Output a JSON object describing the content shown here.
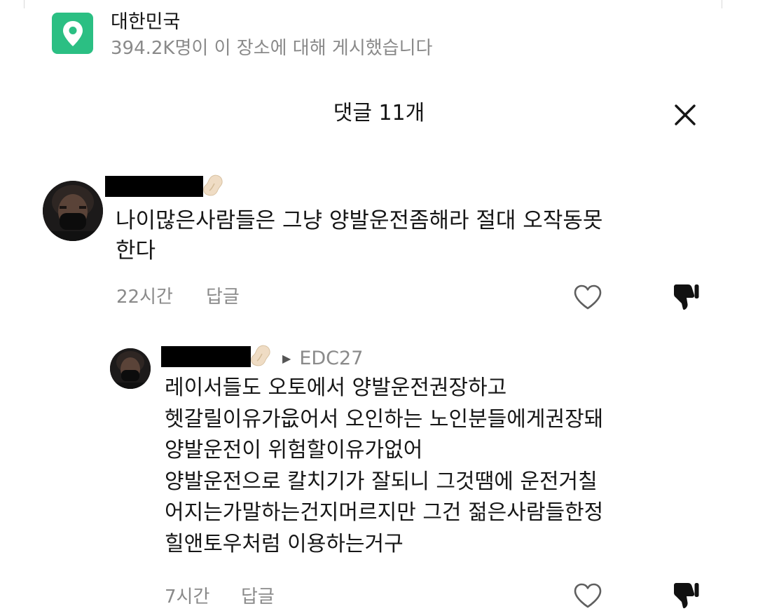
{
  "location": {
    "name": "대한민국",
    "subtitle": "394.2K명이 이 장소에 대해 게시했습니다",
    "icon": "location-pin-icon",
    "accent_color": "#2bbf83"
  },
  "comments_header": {
    "title": "댓글 11개",
    "close_icon": "close-icon"
  },
  "comments": [
    {
      "author_redacted": true,
      "badge_icon": "peanut-badge-icon",
      "text_lines": [
        "나이많은사람들은 그냥 양발운전좀해라 절대 오작동못",
        "한다"
      ],
      "time": "22시간",
      "reply_label": "답글",
      "like_icon": "heart-outline-icon",
      "dislike_icon": "thumbs-down-icon"
    },
    {
      "author_redacted": true,
      "badge_icon": "peanut-badge-icon",
      "reply_to": "EDC27",
      "text_lines": [
        "레이서들도 오토에서 양발운전권장하고",
        "헷갈릴이유가읎어서 오인하는 노인분들에게권장돼",
        "양발운전이 위험할이유가없어",
        "양발운전으로 칼치기가 잘되니 그것땜에 운전거칠",
        "어지는가말하는건지머르지만 그건 젊은사람들한정",
        "힐앤토우처럼 이용하는거구"
      ],
      "time": "7시간",
      "reply_label": "답글",
      "like_icon": "heart-outline-icon",
      "dislike_icon": "thumbs-down-icon"
    }
  ]
}
